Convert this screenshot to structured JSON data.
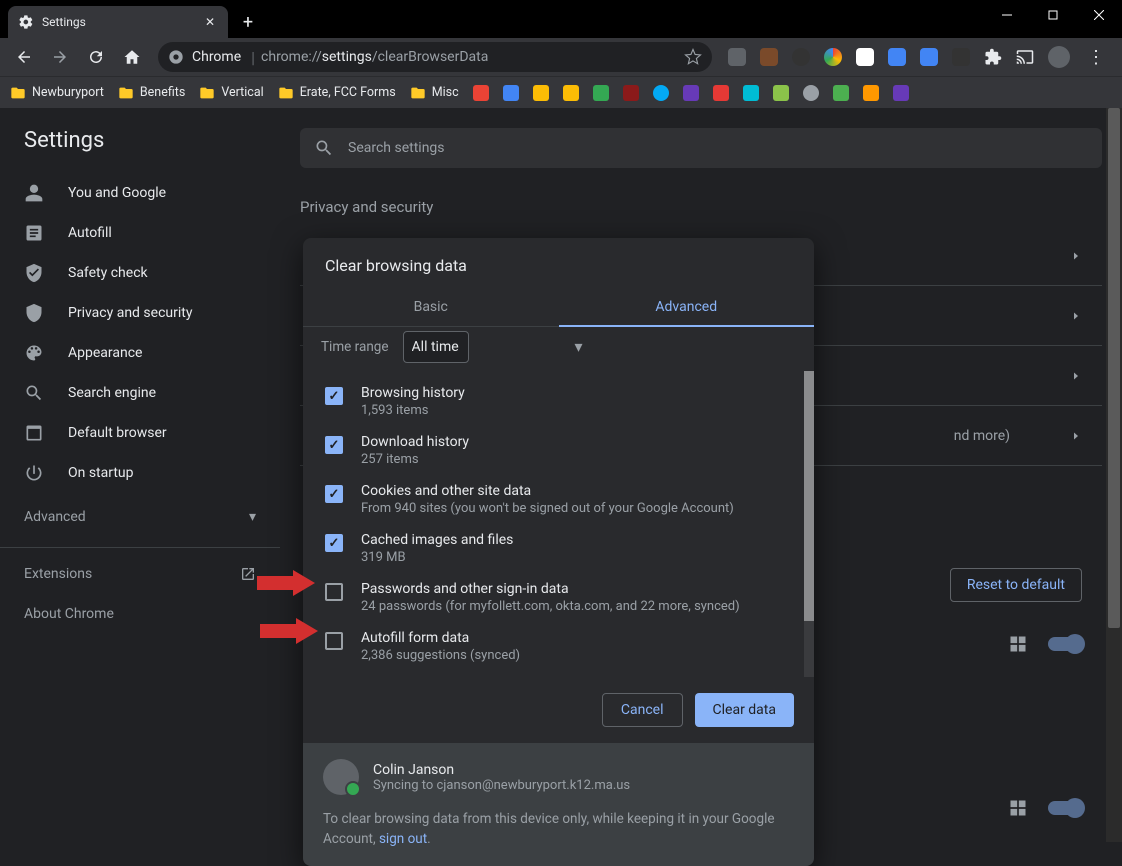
{
  "tab": {
    "title": "Settings"
  },
  "omnibox": {
    "chip": "Chrome",
    "url_prefix": "chrome://",
    "url_hl": "settings",
    "url_suffix": "/clearBrowserData"
  },
  "bookmarks": [
    "Newburyport",
    "Benefits",
    "Vertical",
    "Erate, FCC Forms",
    "Misc"
  ],
  "sidebar": {
    "title": "Settings",
    "items": [
      {
        "label": "You and Google"
      },
      {
        "label": "Autofill"
      },
      {
        "label": "Safety check"
      },
      {
        "label": "Privacy and security"
      },
      {
        "label": "Appearance"
      },
      {
        "label": "Search engine"
      },
      {
        "label": "Default browser"
      },
      {
        "label": "On startup"
      }
    ],
    "advanced": "Advanced",
    "extensions": "Extensions",
    "about": "About Chrome"
  },
  "search_placeholder": "Search settings",
  "section": "Privacy and security",
  "bg_hint": "nd more)",
  "reset_label": "Reset to default",
  "dialog": {
    "title": "Clear browsing data",
    "tab_basic": "Basic",
    "tab_advanced": "Advanced",
    "time_label": "Time range",
    "time_value": "All time",
    "items": [
      {
        "title": "Browsing history",
        "sub": "1,593 items",
        "checked": true
      },
      {
        "title": "Download history",
        "sub": "257 items",
        "checked": true
      },
      {
        "title": "Cookies and other site data",
        "sub": "From 940 sites (you won't be signed out of your Google Account)",
        "checked": true
      },
      {
        "title": "Cached images and files",
        "sub": "319 MB",
        "checked": true
      },
      {
        "title": "Passwords and other sign-in data",
        "sub": "24 passwords (for myfollett.com, okta.com, and 22 more, synced)",
        "checked": false
      },
      {
        "title": "Autofill form data",
        "sub": "2,386 suggestions (synced)",
        "checked": false
      }
    ],
    "cancel": "Cancel",
    "clear": "Clear data",
    "user_name": "Colin Janson",
    "user_sync": "Syncing to cjanson@newburyport.k12.ma.us",
    "sync_msg": "To clear browsing data from this device only, while keeping it in your Google Account, ",
    "sign_out": "sign out"
  }
}
